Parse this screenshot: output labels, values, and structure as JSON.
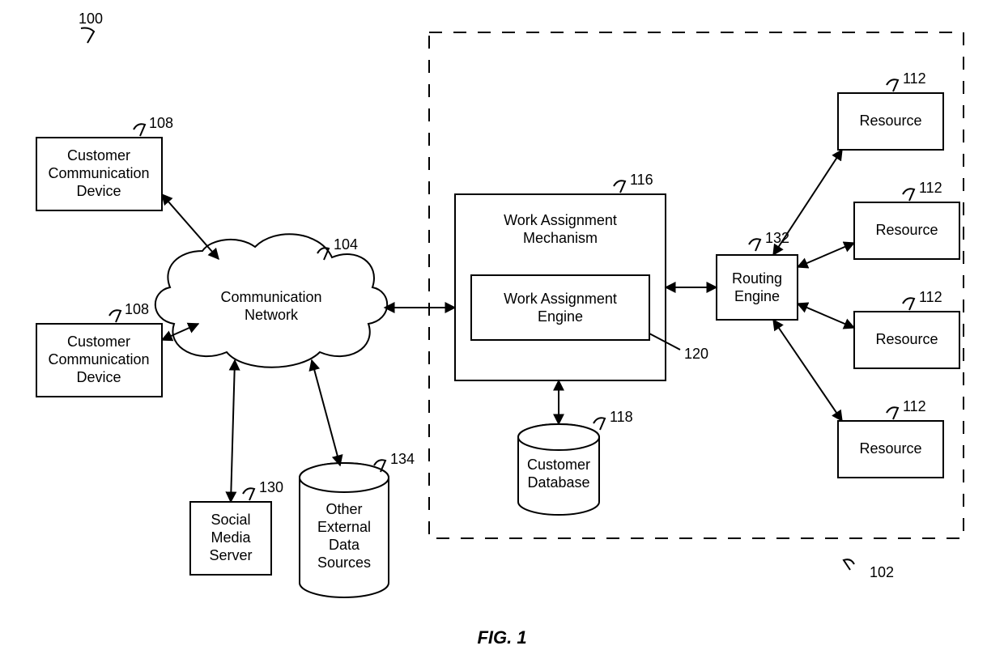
{
  "figure_label": "FIG. 1",
  "refs": {
    "system": "100",
    "contact_center": "102",
    "network": "104",
    "cust_device_1": "108",
    "cust_device_2": "108",
    "resource_1": "112",
    "resource_2": "112",
    "resource_3": "112",
    "resource_4": "112",
    "work_assign_mech": "116",
    "customer_db": "118",
    "work_assign_engine": "120",
    "social_media": "130",
    "routing_engine": "132",
    "ext_sources": "134"
  },
  "labels": {
    "cust_device": "Customer Communication Device",
    "network": "Communication Network",
    "work_assign_mech": "Work Assignment Mechanism",
    "work_assign_engine": "Work Assignment Engine",
    "routing_engine": "Routing Engine",
    "resource": "Resource",
    "customer_db": "Customer Database",
    "social_media": "Social Media Server",
    "ext_sources": "Other External Data Sources"
  }
}
